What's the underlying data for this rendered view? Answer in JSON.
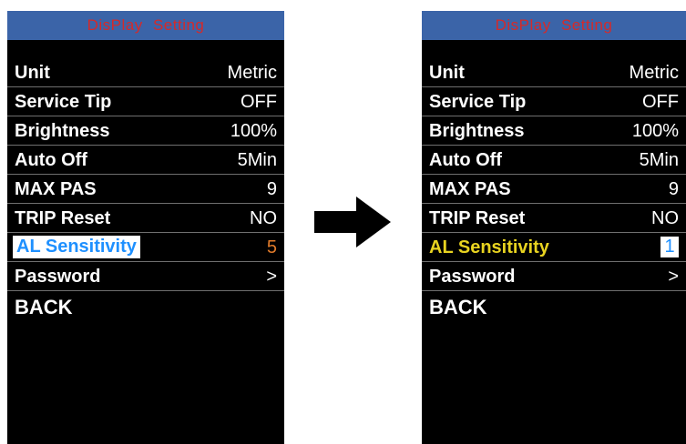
{
  "left_screen": {
    "title": "DisPlay  Setting",
    "rows": [
      {
        "label": "Unit",
        "value": "Metric"
      },
      {
        "label": "Service Tip",
        "value": "OFF"
      },
      {
        "label": "Brightness",
        "value": "100%"
      },
      {
        "label": "Auto Off",
        "value": "5Min"
      },
      {
        "label": "MAX PAS",
        "value": "9"
      },
      {
        "label": "TRIP Reset",
        "value": "NO"
      },
      {
        "label": "AL Sensitivity",
        "value": "5"
      },
      {
        "label": "Password",
        "value": ">"
      }
    ],
    "back": "BACK"
  },
  "right_screen": {
    "title": "DisPlay  Setting",
    "rows": [
      {
        "label": "Unit",
        "value": "Metric"
      },
      {
        "label": "Service Tip",
        "value": "OFF"
      },
      {
        "label": "Brightness",
        "value": "100%"
      },
      {
        "label": "Auto Off",
        "value": "5Min"
      },
      {
        "label": "MAX PAS",
        "value": "9"
      },
      {
        "label": "TRIP Reset",
        "value": "NO"
      },
      {
        "label": "AL Sensitivity",
        "value": "1"
      },
      {
        "label": "Password",
        "value": ">"
      }
    ],
    "back": "BACK"
  },
  "colors": {
    "title_bar": "#3b64a8",
    "title_text": "#d42a2a",
    "selected_label_left": "#1e90ff",
    "selected_value_left": "#e07a2a",
    "selected_label_right": "#e8d320",
    "arrow": "#000000"
  },
  "icons": {
    "transition": "right-arrow-icon"
  }
}
